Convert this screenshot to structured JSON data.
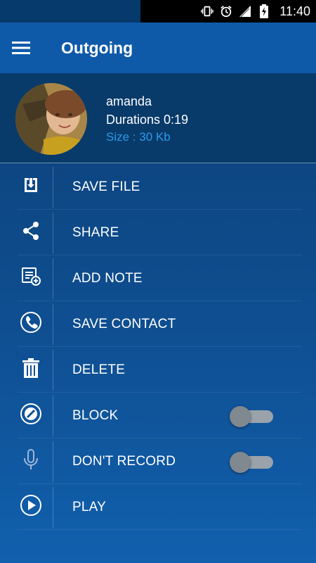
{
  "status_bar": {
    "time": "11:40",
    "icons": [
      "vibrate-icon",
      "alarm-icon",
      "signal-icon",
      "battery-charging-icon"
    ]
  },
  "app_bar": {
    "title": "Outgoing",
    "menu_icon": "hamburger-menu-icon"
  },
  "recording": {
    "name": "amanda",
    "duration": "Durations  0:19",
    "size": "Size : 30 Kb"
  },
  "menu": {
    "items": [
      {
        "label": "SAVE FILE",
        "icon": "save-file-icon"
      },
      {
        "label": "SHARE",
        "icon": "share-icon"
      },
      {
        "label": "ADD NOTE",
        "icon": "add-note-icon"
      },
      {
        "label": "SAVE CONTACT",
        "icon": "phone-icon"
      },
      {
        "label": "DELETE",
        "icon": "trash-icon"
      },
      {
        "label": "BLOCK",
        "icon": "block-icon",
        "toggle": false
      },
      {
        "label": "DON'T RECORD",
        "icon": "microphone-icon",
        "toggle": false
      },
      {
        "label": "PLAY",
        "icon": "play-icon"
      }
    ]
  },
  "colors": {
    "app_bar": "#0f5aa8",
    "profile_bg": "#083a6a",
    "size_text": "#2a9bea",
    "toggle_off": "#9aa3ab"
  }
}
